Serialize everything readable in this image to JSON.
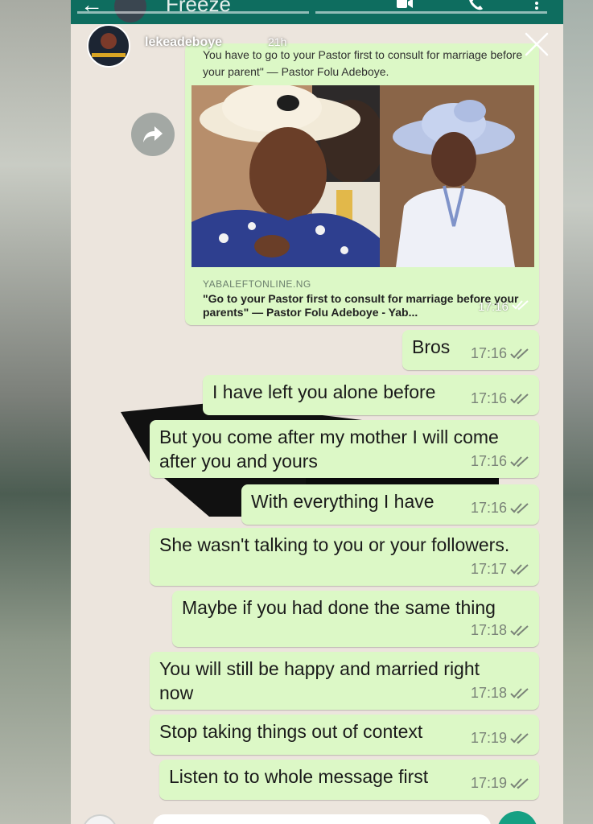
{
  "header": {
    "contact_name": "Freeze"
  },
  "story": {
    "username": "lekeadeboye",
    "time": "21h"
  },
  "link_preview": {
    "quote": "You have to go to your Pastor first to consult for marriage before your parent\" — Pastor Folu Adeboye.",
    "domain": "YABALEFTONLINE.NG",
    "title": "\"Go to your Pastor first to consult for marriage before your parents\" — Pastor Folu Adeboye - Yab...",
    "time": "17:16"
  },
  "messages": [
    {
      "text": "Bros",
      "time": "17:16"
    },
    {
      "text": "I have left you alone before",
      "time": "17:16"
    },
    {
      "text": "But you come after my mother I will come after you and yours",
      "time": "17:16"
    },
    {
      "text": "With everything I have",
      "time": "17:16"
    },
    {
      "text": "She wasn't talking to you or your followers.",
      "time": "17:17"
    },
    {
      "text": "Maybe if you had done the same thing",
      "time": "17:18"
    },
    {
      "text": "You will still be happy and married right now",
      "time": "17:18"
    },
    {
      "text": "Stop taking things out of context",
      "time": "17:19"
    },
    {
      "text": "Listen to to whole message first",
      "time": "17:19"
    }
  ],
  "colors": {
    "header_bg": "#0e6d5f",
    "chat_bg": "#ece5dd",
    "outgoing_bubble": "#dcf8c6",
    "send_button": "#16a083"
  },
  "icons": {
    "back": "back-arrow-icon",
    "video": "video-call-icon",
    "call": "phone-icon",
    "menu": "more-vert-icon",
    "close": "close-icon",
    "forward": "forward-icon",
    "info": "info-icon",
    "read": "double-check-icon"
  }
}
